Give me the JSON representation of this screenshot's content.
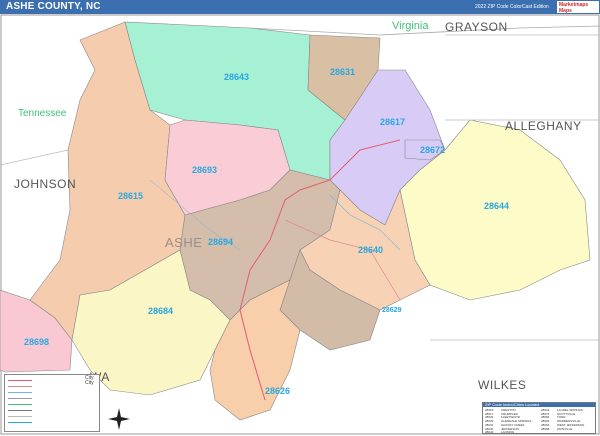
{
  "header": {
    "title": "ASHE COUNTY, NC",
    "subtitle": "2022 ZIP Code ColorCast Edition",
    "logo_line1": "Marketmaps",
    "logo_line2": "Maps"
  },
  "labels": {
    "state_virginia": "Virginia",
    "state_tennessee": "Tennessee",
    "county_grayson": "GRAYSON",
    "county_johnson": "JOHNSON",
    "county_alleghany": "ALLEGHANY",
    "county_ashe": "ASHE",
    "county_wilkes": "WILKES",
    "county_wa": "WA"
  },
  "zips": {
    "z28643": "28643",
    "z28631": "28631",
    "z28617": "28617",
    "z28672": "28672",
    "z28693": "28693",
    "z28615": "28615",
    "z28644": "28644",
    "z28694": "28694",
    "z28640": "28640",
    "z28626": "28626",
    "z28684": "28684",
    "z28698": "28698",
    "z28629": "28629"
  },
  "legend": {
    "city_label": "City",
    "city_label2": "City"
  },
  "ziptable": {
    "title": "ZIP Code Index/Cities Located",
    "rows": [
      [
        "28615",
        "CRESTON",
        "28644",
        "LAUREL SPRINGS"
      ],
      [
        "28617",
        "CRUMPLER",
        "28672",
        "SCOTTVILLE"
      ],
      [
        "28626",
        "FLEETWOOD",
        "28684",
        "TODD"
      ],
      [
        "28629",
        "GLENDALE SPRINGS",
        "28693",
        "WARRENSVILLE"
      ],
      [
        "28631",
        "GRASSY CREEK",
        "28694",
        "WEST JEFFERSON"
      ],
      [
        "28640",
        "JEFFERSON",
        "28698",
        "ZIONVILLE"
      ],
      [
        "28643",
        "LANSING",
        "",
        ""
      ]
    ]
  },
  "colors": {
    "header_bg": "#3b6fb0",
    "zip_label": "#29a8e0",
    "z28643": "#a6f0d4",
    "z28631": "#d9bfa3",
    "z28617": "#d8ccf6",
    "z28693": "#f9ccd6",
    "z28615": "#f6ccae",
    "z28644": "#fdfcc9",
    "z28694": "#d4beab",
    "z28640": "#f8d2b4",
    "z28626": "#f8cfaa",
    "z28684": "#fbf6c6",
    "z28698": "#f9c8d3"
  }
}
